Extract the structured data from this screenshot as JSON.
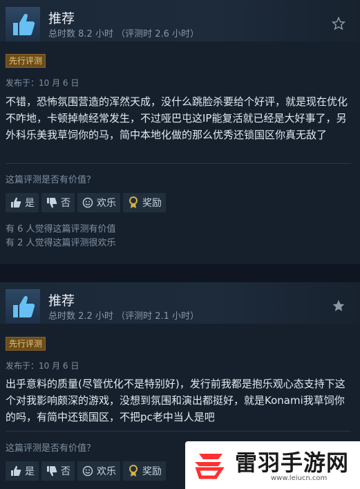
{
  "reviews": [
    {
      "recommendation": "推荐",
      "hours": "总时数 8.2 小时 （评测时 2.6 小时）",
      "badge": "先行评测",
      "posted": "发布于：10 月 6 日",
      "text": "不错，恐怖氛围营造的浑然天成，没什么跳脸杀要给个好评，就是现在优化不咋地，卡顿掉帧经常发生，不过哑巴屯这IP能复活就已经是大好事了，另外科乐美我草饲你的马，简中本地化做的那么优秀还锁国区你真无敌了",
      "helpful_question": "这篇评测是否有价值？",
      "buttons": {
        "yes": "是",
        "no": "否",
        "funny": "欢乐",
        "award": "奖励"
      },
      "helpful_count": "有 6 人觉得这篇评测有价值",
      "funny_count": "有 2 人觉得这篇评测很欢乐"
    },
    {
      "recommendation": "推荐",
      "hours": "总时数 2.2 小时 （评测时 2.1 小时）",
      "badge": "先行评测",
      "posted": "发布于：10 月 6 日",
      "text": "出乎意料的质量(尽管优化不是特别好)，发行前我都是抱乐观心态支持下这个对我影响颇深的游戏，没想到氛围和演出都挺好，就是Konami我草饲你的吗，有简中还锁国区，不把pc老中当人是吧",
      "helpful_question": "这篇评测是否有价值？",
      "buttons": {
        "yes": "是",
        "no": "否",
        "funny": "欢乐",
        "award": "奖励"
      }
    }
  ],
  "watermark": {
    "name": "雷羽手游网",
    "url": "www.leiucn.com"
  },
  "colors": {
    "background": "#16202d",
    "badge": "#6b4c1c",
    "award": "#d6b341",
    "accent": "#ff3030"
  },
  "icons": [
    "thumbs-up-icon",
    "thumbs-down-icon",
    "smile-icon",
    "award-icon",
    "star-icon"
  ]
}
